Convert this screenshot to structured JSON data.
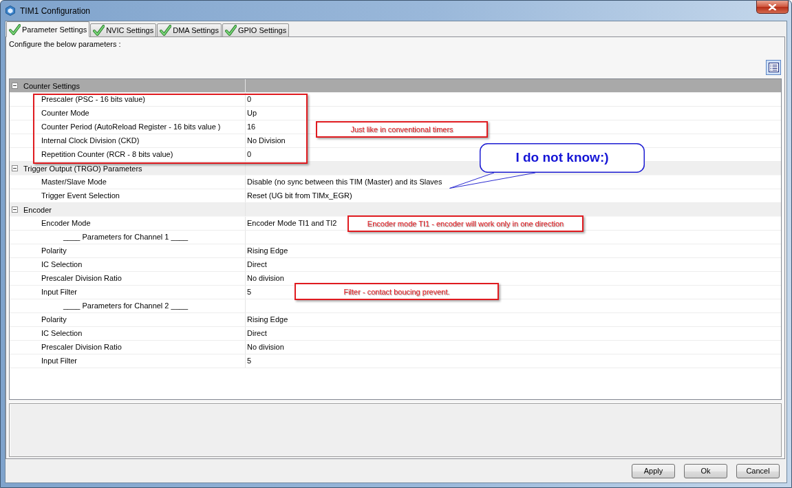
{
  "window": {
    "title": "TIM1 Configuration"
  },
  "tabs": [
    {
      "label": "Parameter Settings",
      "selected": true
    },
    {
      "label": "NVIC Settings",
      "selected": false
    },
    {
      "label": "DMA Settings",
      "selected": false
    },
    {
      "label": "GPIO Settings",
      "selected": false
    }
  ],
  "intro": "Configure the below parameters :",
  "groups": [
    {
      "label": "Counter Settings",
      "expanded": true,
      "selected": true,
      "rows": [
        {
          "kind": "param",
          "label": "Prescaler (PSC - 16 bits value)",
          "value": "0",
          "selected": false
        },
        {
          "kind": "param",
          "label": "Counter Mode",
          "value": "Up",
          "selected": false
        },
        {
          "kind": "param",
          "label": "Counter Period (AutoReload Register - 16 bits value )",
          "value": "16",
          "selected": false
        },
        {
          "kind": "param",
          "label": "Internal Clock Division (CKD)",
          "value": "No Division",
          "selected": false
        },
        {
          "kind": "param",
          "label": "Repetition Counter (RCR - 8 bits value)",
          "value": "0",
          "selected": false
        }
      ]
    },
    {
      "label": "Trigger Output (TRGO) Parameters",
      "expanded": true,
      "selected": false,
      "rows": [
        {
          "kind": "param",
          "label": "Master/Slave Mode",
          "value": "Disable (no sync between this TIM (Master) and its Slaves",
          "selected": false
        },
        {
          "kind": "param",
          "label": "Trigger Event Selection",
          "value": "Reset (UG bit from TIMx_EGR)",
          "selected": false
        }
      ]
    },
    {
      "label": "Encoder",
      "expanded": true,
      "selected": false,
      "rows": [
        {
          "kind": "param",
          "label": "Encoder Mode",
          "value": "Encoder Mode TI1 and TI2",
          "selected": false
        },
        {
          "kind": "heading",
          "label": "____ Parameters for Channel 1 ____",
          "selected": false
        },
        {
          "kind": "param",
          "label": "Polarity",
          "value": "Rising Edge",
          "selected": false
        },
        {
          "kind": "param",
          "label": "IC Selection",
          "value": "Direct",
          "selected": false
        },
        {
          "kind": "param",
          "label": "Prescaler Division Ratio",
          "value": "No division",
          "selected": false
        },
        {
          "kind": "param",
          "label": "Input Filter",
          "value": "5",
          "selected": false
        },
        {
          "kind": "heading",
          "label": "____ Parameters for Channel 2 ____",
          "selected": false
        },
        {
          "kind": "param",
          "label": "Polarity",
          "value": "Rising Edge",
          "selected": false
        },
        {
          "kind": "param",
          "label": "IC Selection",
          "value": "Direct",
          "selected": false
        },
        {
          "kind": "param",
          "label": "Prescaler Division Ratio",
          "value": "No division",
          "selected": false
        },
        {
          "kind": "param",
          "label": "Input Filter",
          "value": "5",
          "selected": false
        }
      ]
    }
  ],
  "annotations": [
    {
      "kind": "frame"
    },
    {
      "kind": "note",
      "text": "Just like in conventional timers"
    },
    {
      "kind": "callout",
      "text": "I do not know:)"
    },
    {
      "kind": "note",
      "text": "Encoder mode TI1 - encoder will work only in one direction"
    },
    {
      "kind": "note",
      "text": "Filter - contact boucing prevent."
    }
  ],
  "buttons": [
    {
      "label": "Apply"
    },
    {
      "label": "Ok"
    },
    {
      "label": "Cancel"
    }
  ]
}
